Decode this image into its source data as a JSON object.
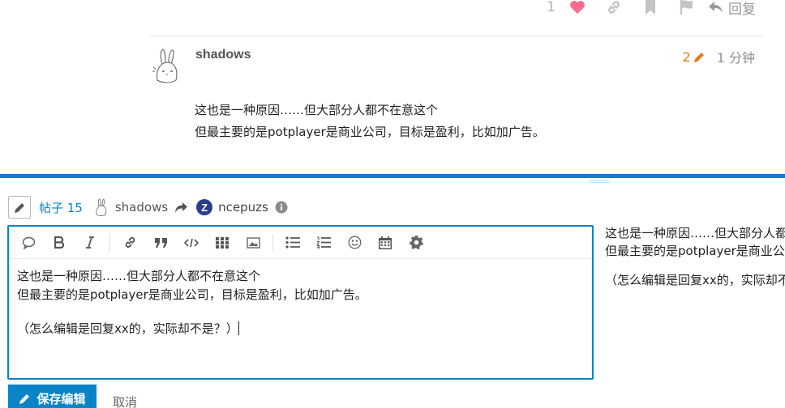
{
  "post_actions": {
    "like_count": "1",
    "reply_label": "回复"
  },
  "post": {
    "username": "shadows",
    "edit_count": "2",
    "time": "1 分钟",
    "lines": [
      "这也是一种原因……但大部分人都不在意这个",
      "但最主要的是potplayer是商业公司，目标是盈利，比如加广告。"
    ]
  },
  "composer": {
    "reply_to": {
      "post_link": "帖子 15",
      "from_user": "shadows",
      "to_user": "ncepuzs",
      "to_user_initial": "Z"
    },
    "editor": {
      "line1": "这也是一种原因……但大部分人都不在意这个",
      "line2": "但最主要的是potplayer是商业公司，目标是盈利，比如加广告。",
      "line3": "（怎么编辑是回复xx的，实际却不是？）"
    },
    "preview": {
      "line1": "这也是一种原因……但大部分人都不在意这个",
      "line2": "但最主要的是potplayer是商业公司，目标是盈利，比如加广告。",
      "line3": "（怎么编辑是回复xx的，实际却不是？）"
    },
    "save_label": "保存编辑",
    "cancel_label": "取消"
  },
  "colors": {
    "accent": "#0a84c6",
    "edit_orange": "#e67a1e",
    "like_pink": "#fa6c8d",
    "avatar_z": "#2e3d8a"
  }
}
